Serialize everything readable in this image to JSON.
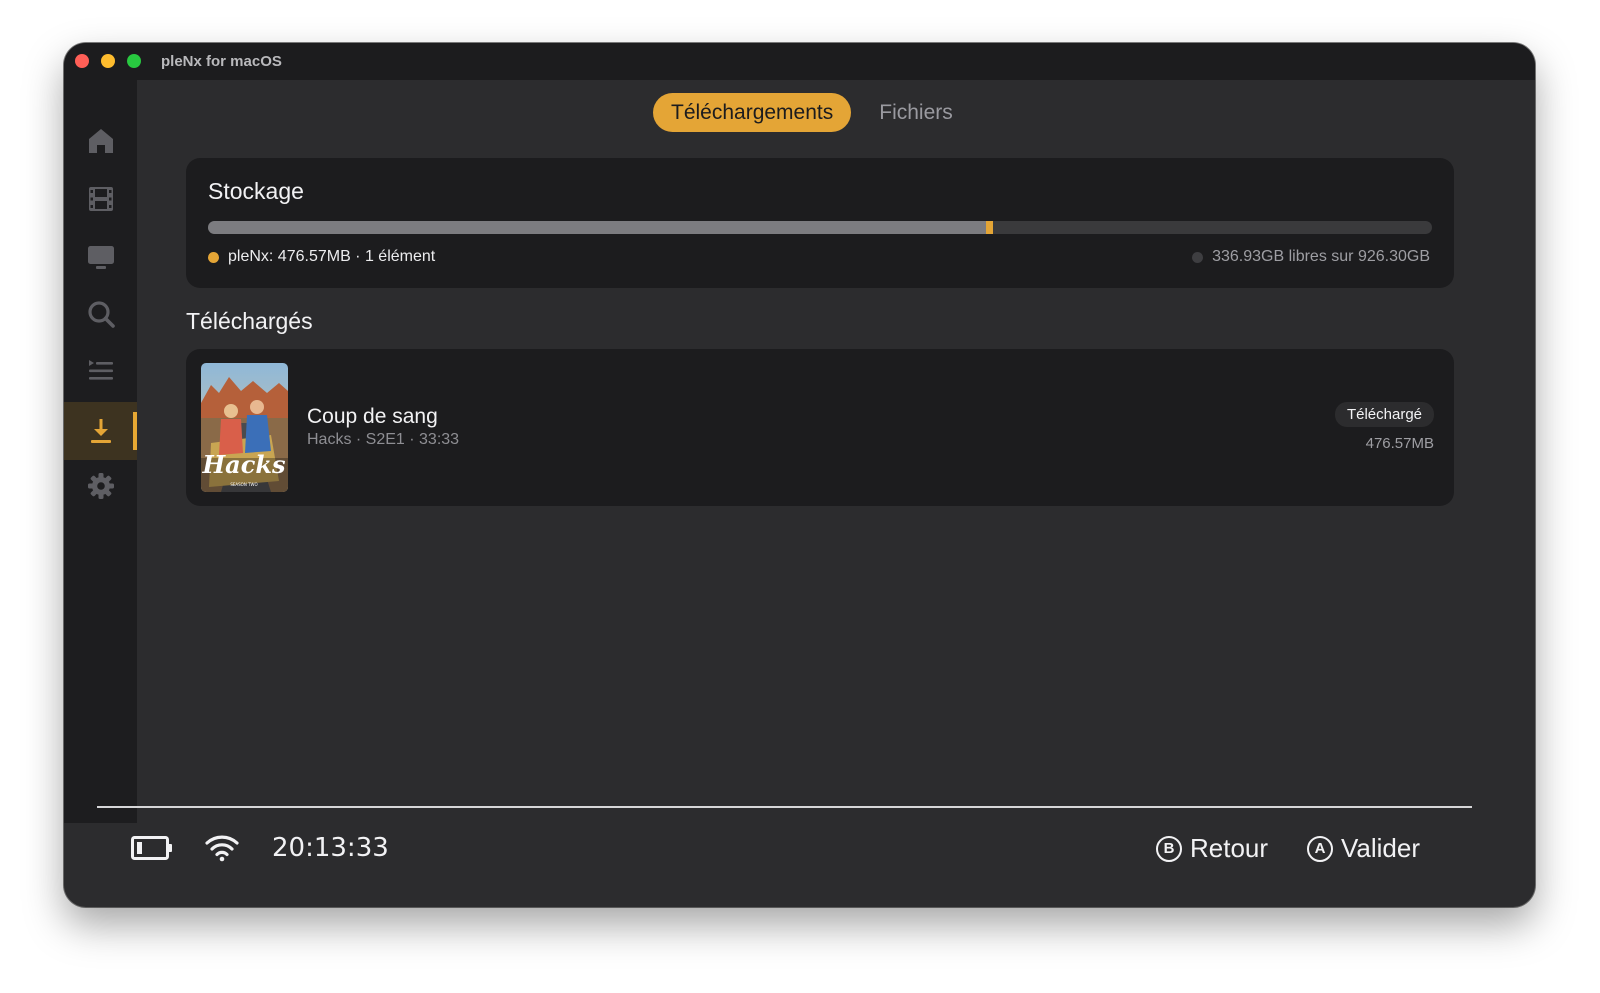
{
  "window": {
    "title": "pleNx for macOS"
  },
  "sidebar": {
    "items": [
      {
        "icon": "home-icon",
        "active": false
      },
      {
        "icon": "film-icon",
        "active": false
      },
      {
        "icon": "tv-icon",
        "active": false
      },
      {
        "icon": "search-icon",
        "active": false
      },
      {
        "icon": "queue-list-icon",
        "active": false
      },
      {
        "icon": "download-icon",
        "active": true
      },
      {
        "icon": "gear-icon",
        "active": false
      }
    ]
  },
  "tabs": [
    {
      "label": "Téléchargements",
      "active": true
    },
    {
      "label": "Fichiers",
      "active": false
    }
  ],
  "storage": {
    "title": "Stockage",
    "app_label": "pleNx: 476.57MB · 1 élément",
    "free_label": "336.93GB libres sur 926.30GB",
    "used_fraction": 0.636,
    "app_fraction": 0.0005
  },
  "downloaded": {
    "title": "Téléchargés",
    "items": [
      {
        "title": "Coup de sang",
        "subtitle": "Hacks · S2E1 · 33:33",
        "poster_text": "Hacks",
        "poster_sub": "SEASON TWO",
        "badge": "Téléchargé",
        "size": "476.57MB"
      }
    ]
  },
  "footer": {
    "clock": "20:13:33",
    "back_button": "B",
    "back_label": "Retour",
    "confirm_button": "A",
    "confirm_label": "Valider"
  },
  "colors": {
    "accent": "#e4a536",
    "background": "#2c2c2e",
    "card": "#1c1c1e"
  }
}
